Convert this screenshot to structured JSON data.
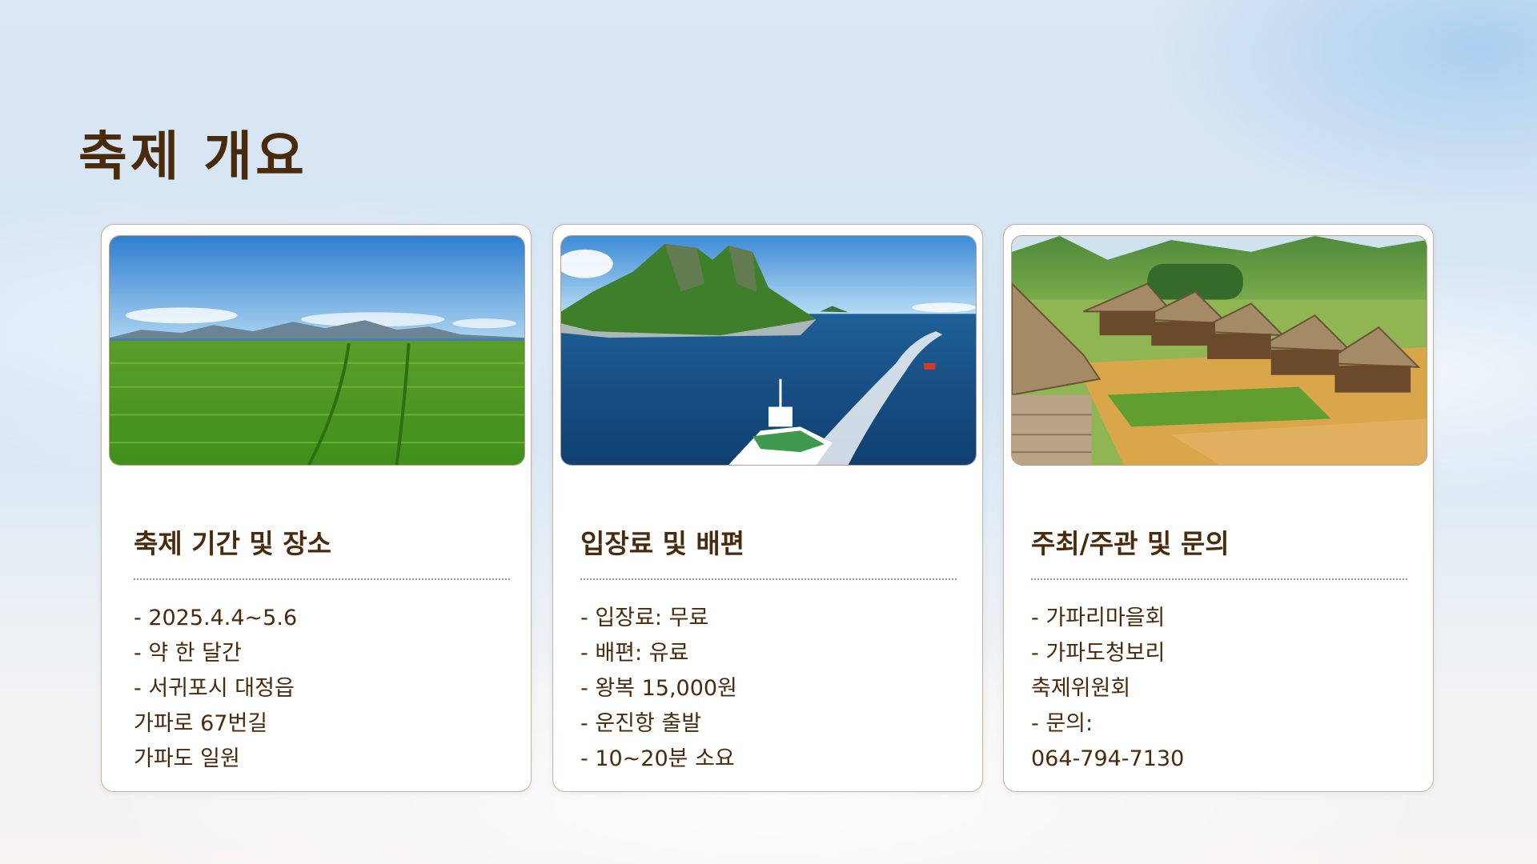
{
  "title": "축제 개요",
  "cards": [
    {
      "heading": "축제 기간 및 장소",
      "image": "green-barley-field-photo",
      "lines": [
        "- 2025.4.4~5.6",
        "- 약 한 달간",
        "- 서귀포시 대정읍",
        "가파로 67번길",
        "가파도 일원"
      ]
    },
    {
      "heading": "입장료 및 배편",
      "image": "island-ferry-photo",
      "lines": [
        "- 입장료: 무료",
        "- 배편: 유료",
        "- 왕복 15,000원",
        "- 운진항 출발",
        "- 10~20분 소요"
      ]
    },
    {
      "heading": "주최/주관 및 문의",
      "image": "thatched-village-photo",
      "lines": [
        "- 가파리마을회",
        "- 가파도청보리",
        "축제위원회",
        "- 문의:",
        "064-794-7130"
      ]
    }
  ],
  "colors": {
    "title": "#4a2a0c",
    "card_border": "#c9b09b",
    "text": "#4a2a0c"
  }
}
